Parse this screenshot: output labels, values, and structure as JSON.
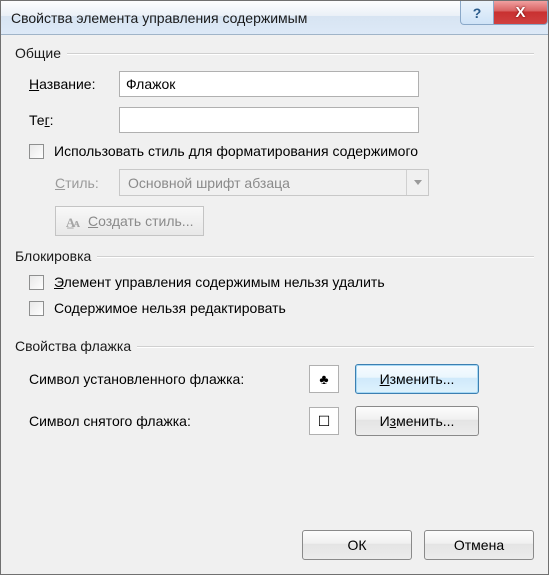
{
  "titlebar": {
    "title": "Свойства элемента управления содержимым",
    "help": "?",
    "close": "X"
  },
  "groups": {
    "general": {
      "title": "Общие",
      "name_label": "Название:",
      "name_value": "Флажок",
      "tag_label": "Тег:",
      "tag_value": "",
      "use_style_label": "Использовать стиль для форматирования содержимого",
      "style_label": "Стиль:",
      "style_value": "Основной шрифт абзаца",
      "new_style_label": "Создать стиль..."
    },
    "locking": {
      "title": "Блокировка",
      "cannot_delete_label": "Элемент управления содержимым нельзя удалить",
      "cannot_edit_label": "Содержимое нельзя редактировать"
    },
    "checkbox_props": {
      "title": "Свойства флажка",
      "checked_label": "Символ установленного флажка:",
      "checked_symbol": "♣",
      "unchecked_label": "Символ снятого флажка:",
      "unchecked_symbol": "☐",
      "change_label": "Изменить..."
    }
  },
  "footer": {
    "ok": "ОК",
    "cancel": "Отмена"
  }
}
